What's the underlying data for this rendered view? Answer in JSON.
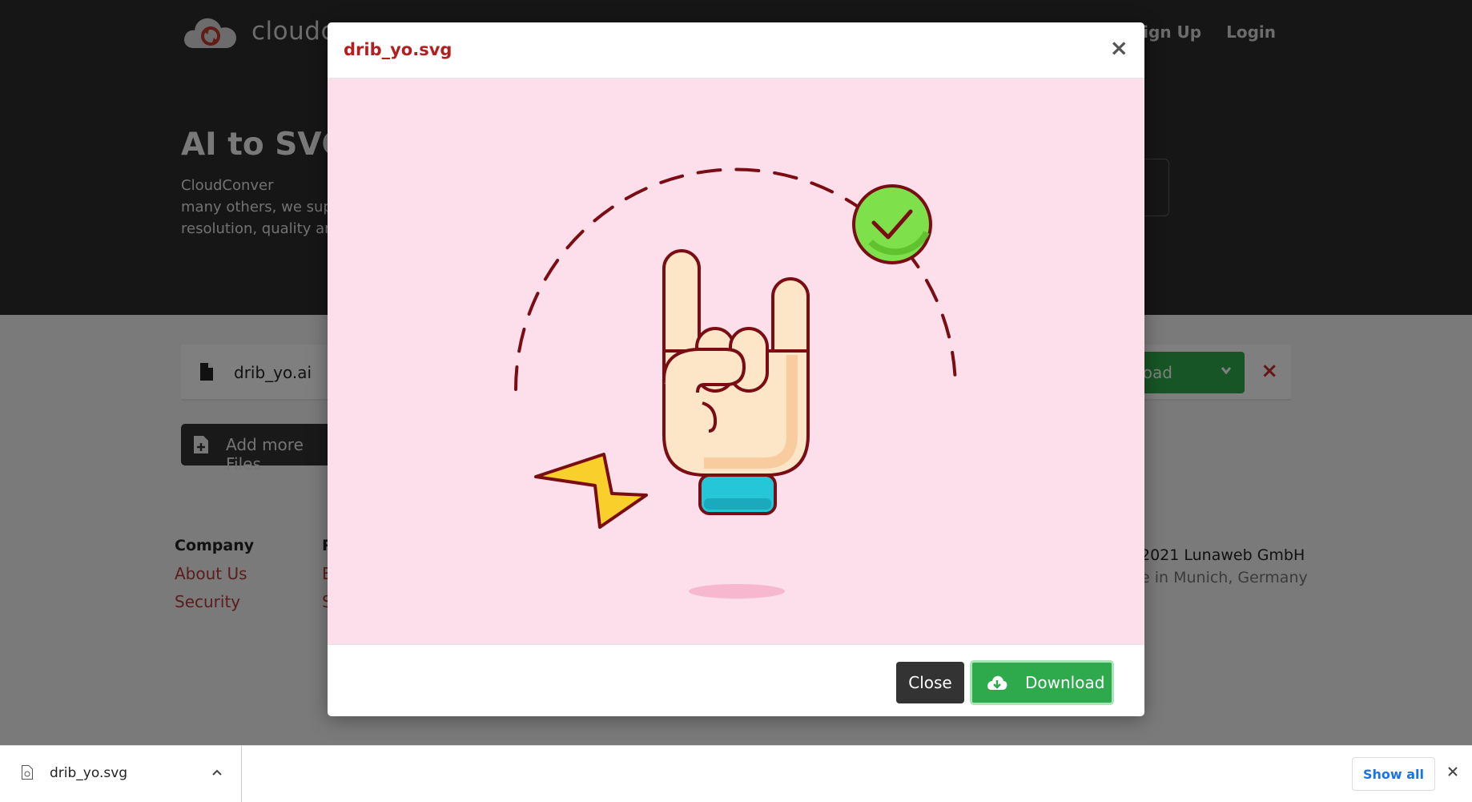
{
  "app": {
    "logo_text": "cloudc",
    "nav": {
      "signup": "Sign Up",
      "login": "Login"
    }
  },
  "hero": {
    "title": "AI to SVG",
    "description": "CloudConver\nmany others, we sup\nresolution, quality an"
  },
  "file_row": {
    "file_name": "drib_yo.ai",
    "download_label": "nload",
    "remove_symbol": "×"
  },
  "add_files": {
    "label": "Add more Files"
  },
  "footer": {
    "company_heading": "Company",
    "company_links": [
      "About Us",
      "Security"
    ],
    "col2_heading": "R",
    "col2_links": [
      "E",
      "S"
    ],
    "copyright": "2021 Lunaweb GmbH",
    "made_in": "e in Munich, Germany"
  },
  "modal": {
    "title": "drib_yo.svg",
    "close_symbol": "×",
    "close_button": "Close",
    "download_button": "Download"
  },
  "shelf": {
    "file_name": "drib_yo.svg",
    "show_all": "Show all"
  },
  "colors": {
    "accent_red": "#b31f1f",
    "success_green": "#2eaa4c",
    "preview_bg": "#fcdfea"
  },
  "icons": [
    "cloudconvert-logo-icon",
    "file-icon",
    "chevron-down-icon",
    "file-plus-icon",
    "close-icon",
    "cloud-download-icon",
    "chevron-up-icon"
  ]
}
